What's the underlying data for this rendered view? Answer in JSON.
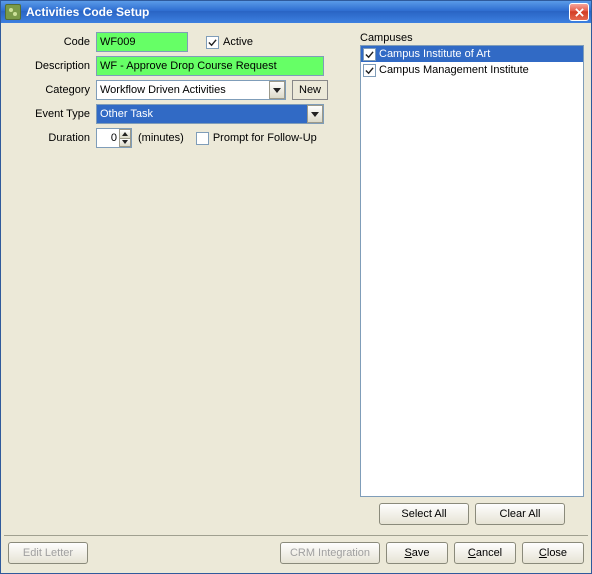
{
  "window": {
    "title": "Activities Code Setup"
  },
  "fields": {
    "code_label": "Code",
    "code_value": "WF009",
    "active_label": "Active",
    "active_checked": true,
    "description_label": "Description",
    "description_value": "WF - Approve Drop Course Request",
    "category_label": "Category",
    "category_value": "Workflow Driven Activities",
    "new_btn": "New",
    "event_type_label": "Event Type",
    "event_type_value": "Other Task",
    "duration_label": "Duration",
    "duration_value": "0",
    "duration_units": "(minutes)",
    "prompt_followup_label": "Prompt for Follow-Up",
    "prompt_followup_checked": false
  },
  "campuses": {
    "label": "Campuses",
    "items": [
      {
        "name": "Campus Institute of Art",
        "checked": true,
        "selected": true
      },
      {
        "name": "Campus Management Institute",
        "checked": true,
        "selected": false
      }
    ],
    "select_all": "Select All",
    "clear_all": "Clear All"
  },
  "buttons": {
    "edit_letter": "Edit Letter",
    "crm_integration": "CRM Integration",
    "save": "Save",
    "save_mnemonic_index": 0,
    "cancel": "Cancel",
    "cancel_mnemonic_index": 0,
    "close": "Close",
    "close_mnemonic_index": 0
  }
}
